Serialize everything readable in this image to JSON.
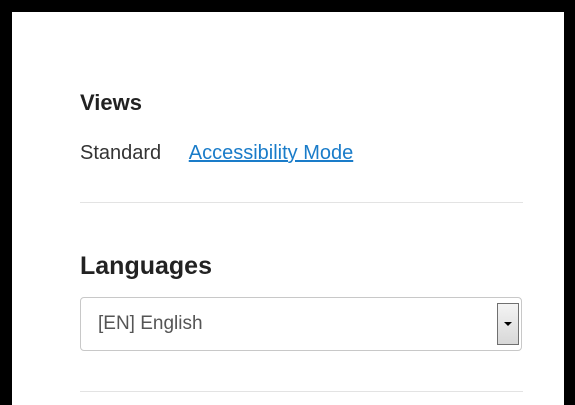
{
  "views": {
    "heading": "Views",
    "standard_label": "Standard",
    "accessibility_link": "Accessibility Mode"
  },
  "languages": {
    "heading": "Languages",
    "selected": "[EN] English"
  },
  "colors": {
    "link": "#1a7cc9",
    "frame": "#000000",
    "divider": "#e3e3e3"
  }
}
